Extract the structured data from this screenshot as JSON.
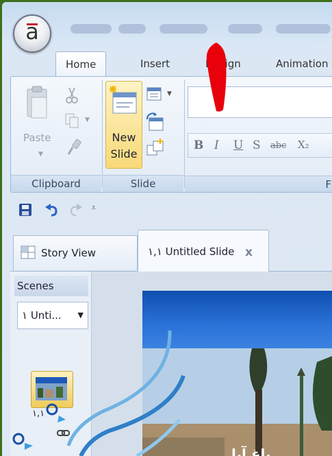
{
  "ribbon_tabs": [
    {
      "label": "Home"
    },
    {
      "label": "Insert"
    },
    {
      "label": "Design"
    },
    {
      "label": "Animation"
    }
  ],
  "clipboard": {
    "paste_label": "Paste",
    "group_label": "Clipboard"
  },
  "slide_group": {
    "new_slide_line1": "New",
    "new_slide_line2": "Slide",
    "group_label": "Slide"
  },
  "font_group": {
    "font_name_value": "",
    "buttons": [
      "B",
      "I",
      "U",
      "S",
      "abc",
      "X₂"
    ],
    "group_label": "F"
  },
  "quick_access": {
    "icons": [
      "save-icon",
      "undo-icon",
      "redo-icon",
      "customize-icon"
    ]
  },
  "document_tabs": {
    "story_view": "Story View",
    "slide_tab": "١,١ Untitled Slide",
    "close_glyph": "x"
  },
  "scenes_panel": {
    "header": "Scenes",
    "selected_scene": "١ Unti...",
    "thumbnail_caption": "١,١"
  },
  "slide_canvas": {
    "overlay_text": "باغ آبا"
  },
  "colors": {
    "accent_arrow": "#e8000b",
    "new_slide_highlight": "#f8d978",
    "ribbon_border": "#9fb6d3",
    "slide_header_blue": "#1c5fc4",
    "outer_background": "#3d6f1b"
  }
}
